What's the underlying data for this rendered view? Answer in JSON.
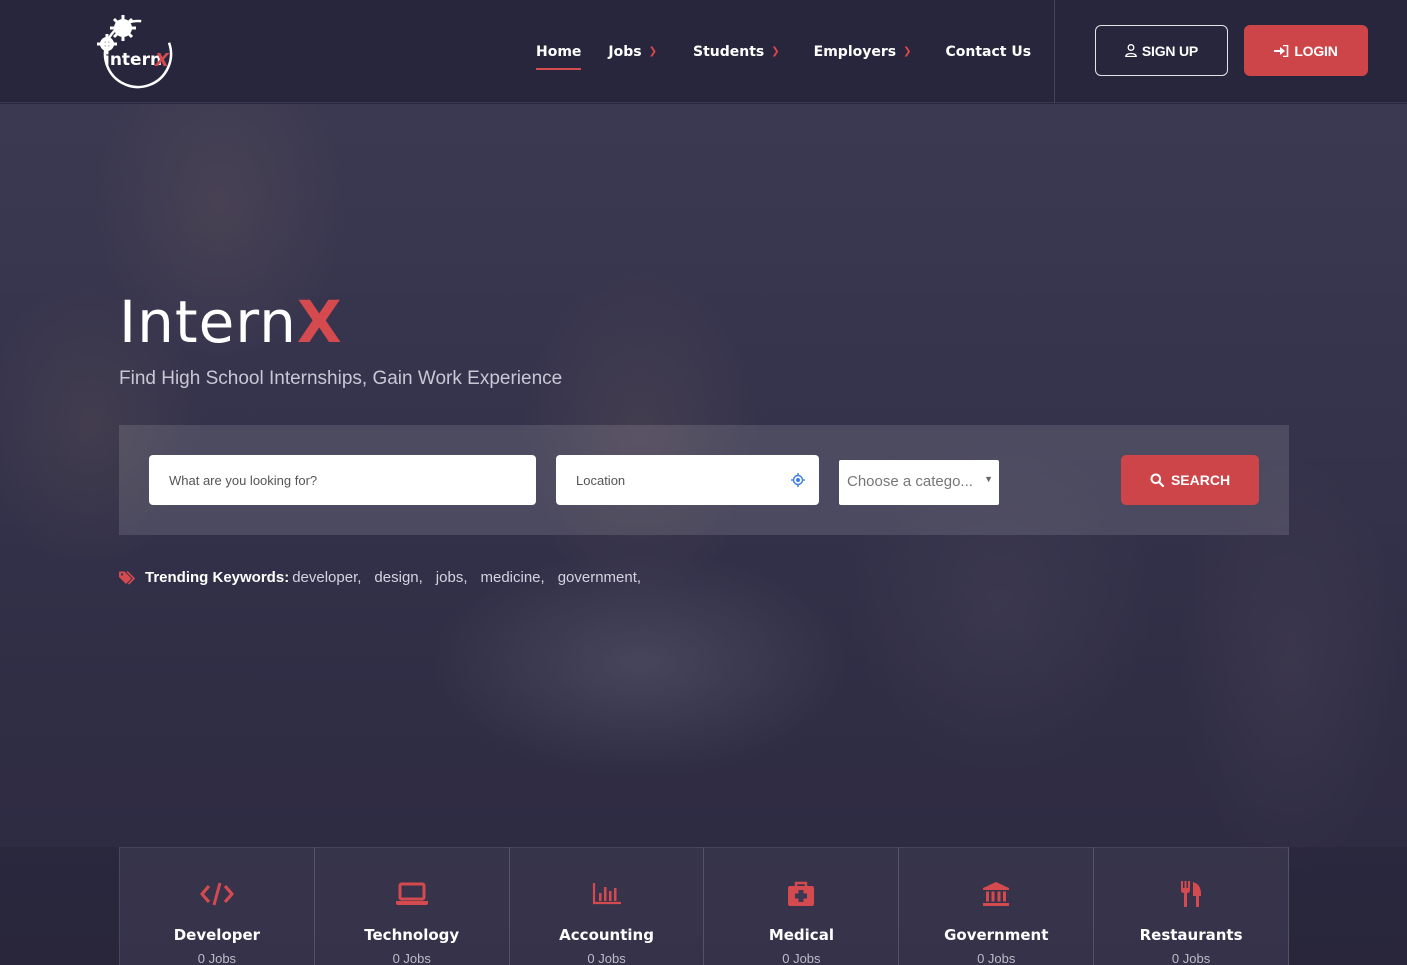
{
  "brand": {
    "logo_text": "internX",
    "accent": "#d44a4f"
  },
  "nav": {
    "items": [
      {
        "label": "Home",
        "active": true,
        "dropdown": false
      },
      {
        "label": "Jobs",
        "active": false,
        "dropdown": true
      },
      {
        "label": "Students",
        "active": false,
        "dropdown": true
      },
      {
        "label": "Employers",
        "active": false,
        "dropdown": true
      },
      {
        "label": "Contact Us",
        "active": false,
        "dropdown": false
      }
    ],
    "signup_label": "SIGN UP",
    "login_label": "LOGIN"
  },
  "hero": {
    "title_main": "Intern",
    "title_accent": "X",
    "subtitle": "Find High School Internships, Gain Work Experience"
  },
  "search": {
    "keyword_placeholder": "What are you looking for?",
    "location_placeholder": "Location",
    "category_value": "Choose a catego...",
    "button_label": "SEARCH"
  },
  "trending": {
    "label": "Trending Keywords:",
    "keywords": [
      "developer,",
      "design,",
      "jobs,",
      "medicine,",
      "government,"
    ]
  },
  "categories": [
    {
      "name": "Developer",
      "count": "0 Jobs",
      "icon": "code-icon"
    },
    {
      "name": "Technology",
      "count": "0 Jobs",
      "icon": "laptop-icon"
    },
    {
      "name": "Accounting",
      "count": "0 Jobs",
      "icon": "bar-chart-icon"
    },
    {
      "name": "Medical",
      "count": "0 Jobs",
      "icon": "medkit-icon"
    },
    {
      "name": "Government",
      "count": "0 Jobs",
      "icon": "bank-icon"
    },
    {
      "name": "Restaurants",
      "count": "0 Jobs",
      "icon": "cutlery-icon"
    }
  ]
}
